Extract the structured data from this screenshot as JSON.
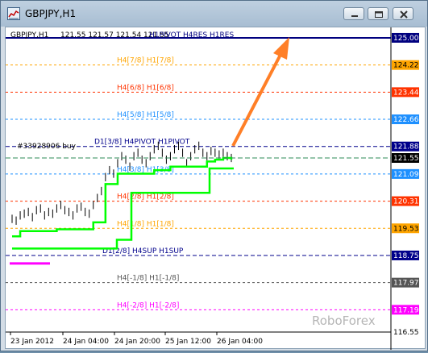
{
  "window": {
    "title": "GBPJPY,H1",
    "icon": "chart-window-icon",
    "controls": [
      "minimize-icon",
      "maximize-icon",
      "close-icon"
    ]
  },
  "header": {
    "symbol_label": "GBPJPY,H1",
    "ohlc": "121.55 121.57 121.54 121.55",
    "level_note": "H1PIVOT H4RES H1RES"
  },
  "order_label": "#33928906 buy",
  "watermark": "RoboForex",
  "colors": {
    "murrey_top": "#00007f",
    "resistance": "#ff3300",
    "ultimate": "#ffa500",
    "mid": "#1e90ff",
    "support_bound": "#00008b",
    "neutral": "#555555",
    "price_channel": "#00ff00",
    "price_bars": "#000000",
    "magenta": "#ff00ff",
    "arrow": "#ff7f27"
  },
  "chart_data": {
    "type": "line",
    "title": "GBPJPY,H1",
    "xlabel": "",
    "ylabel": "",
    "ylim": [
      116.55,
      125.3
    ],
    "x_ticks": [
      "23 Jan 2012",
      "24 Jan 04:00",
      "24 Jan 20:00",
      "25 Jan 12:00",
      "26 Jan 04:00"
    ],
    "y_ticks": [
      "125.00",
      "124.22",
      "123.44",
      "122.66",
      "121.88",
      "121.55",
      "121.09",
      "120.31",
      "119.53",
      "118.75",
      "117.97",
      "117.19",
      "116.55"
    ],
    "current_price": 121.55,
    "levels": [
      {
        "price": 125.0,
        "label": "H4[8/8] H1[8/8]",
        "color": "#00007f"
      },
      {
        "price": 124.22,
        "label": "H4[7/8] H1[7/8]",
        "color": "#ffa500"
      },
      {
        "price": 123.44,
        "label": "H4[6/8] H1[6/8]",
        "color": "#ff3300"
      },
      {
        "price": 122.66,
        "label": "H4[5/8] H1[5/8]",
        "color": "#1e90ff"
      },
      {
        "price": 121.88,
        "label": "D1[3/8] H4PIVOT H1PIVOT",
        "color": "#00008b"
      },
      {
        "price": 121.09,
        "label": "H4[3/8] H1[3/8]",
        "color": "#1e90ff"
      },
      {
        "price": 120.31,
        "label": "H4[2/8] H1[2/8]",
        "color": "#ff3300"
      },
      {
        "price": 119.53,
        "label": "H4[1/8] H1[1/8]",
        "color": "#ffa500"
      },
      {
        "price": 118.75,
        "label": "D1[2/8] H4SUP H1SUP",
        "color": "#00008b"
      },
      {
        "price": 117.97,
        "label": "H4[-1/8] H1[-1/8]",
        "color": "#555555"
      },
      {
        "price": 117.19,
        "label": "H4[-2/8] H1[-2/8]",
        "color": "#ff00ff"
      }
    ],
    "series": [
      {
        "name": "Price",
        "values": [
          119.8,
          119.75,
          119.9,
          119.95,
          120.0,
          119.85,
          120.05,
          120.1,
          119.9,
          120.0,
          119.95,
          120.1,
          120.2,
          120.05,
          120.0,
          119.9,
          120.1,
          120.15,
          120.0,
          119.95,
          120.2,
          120.4,
          120.6,
          121.0,
          121.2,
          121.1,
          121.4,
          121.6,
          121.5,
          121.3,
          121.6,
          121.7,
          121.5,
          121.4,
          121.6,
          121.8,
          121.9,
          121.7,
          121.5,
          121.6,
          121.8,
          121.9,
          121.7,
          121.4,
          121.6,
          121.8,
          121.9,
          121.7,
          121.6,
          121.75,
          121.7,
          121.65,
          121.7,
          121.6,
          121.55
        ]
      },
      {
        "name": "Upper Channel",
        "values": [
          119.3,
          119.3,
          119.45,
          119.45,
          119.45,
          119.45,
          119.45,
          119.45,
          119.45,
          119.45,
          119.45,
          119.5,
          119.5,
          119.5,
          119.5,
          119.5,
          119.5,
          119.5,
          119.5,
          119.5,
          119.7,
          119.7,
          119.7,
          120.8,
          120.8,
          120.8,
          121.1,
          121.1,
          121.1,
          121.1,
          121.1,
          121.1,
          121.1,
          121.1,
          121.1,
          121.2,
          121.2,
          121.2,
          121.2,
          121.3,
          121.3,
          121.3,
          121.3,
          121.3,
          121.3,
          121.3,
          121.3,
          121.3,
          121.45,
          121.45,
          121.5,
          121.5,
          121.55,
          121.55,
          121.5
        ]
      },
      {
        "name": "Lower Channel",
        "values": [
          null,
          null,
          null,
          null,
          null,
          null,
          null,
          null,
          null,
          null,
          null,
          null,
          null,
          null,
          null,
          null,
          null,
          null,
          null,
          null,
          null,
          null,
          null,
          null,
          null,
          null,
          null,
          null,
          null,
          null,
          null,
          null,
          null,
          null,
          null,
          null,
          null,
          null,
          null,
          null,
          null,
          null,
          null,
          null,
          null,
          null,
          null,
          null,
          null,
          null,
          null,
          null,
          null,
          null,
          null
        ]
      }
    ]
  }
}
